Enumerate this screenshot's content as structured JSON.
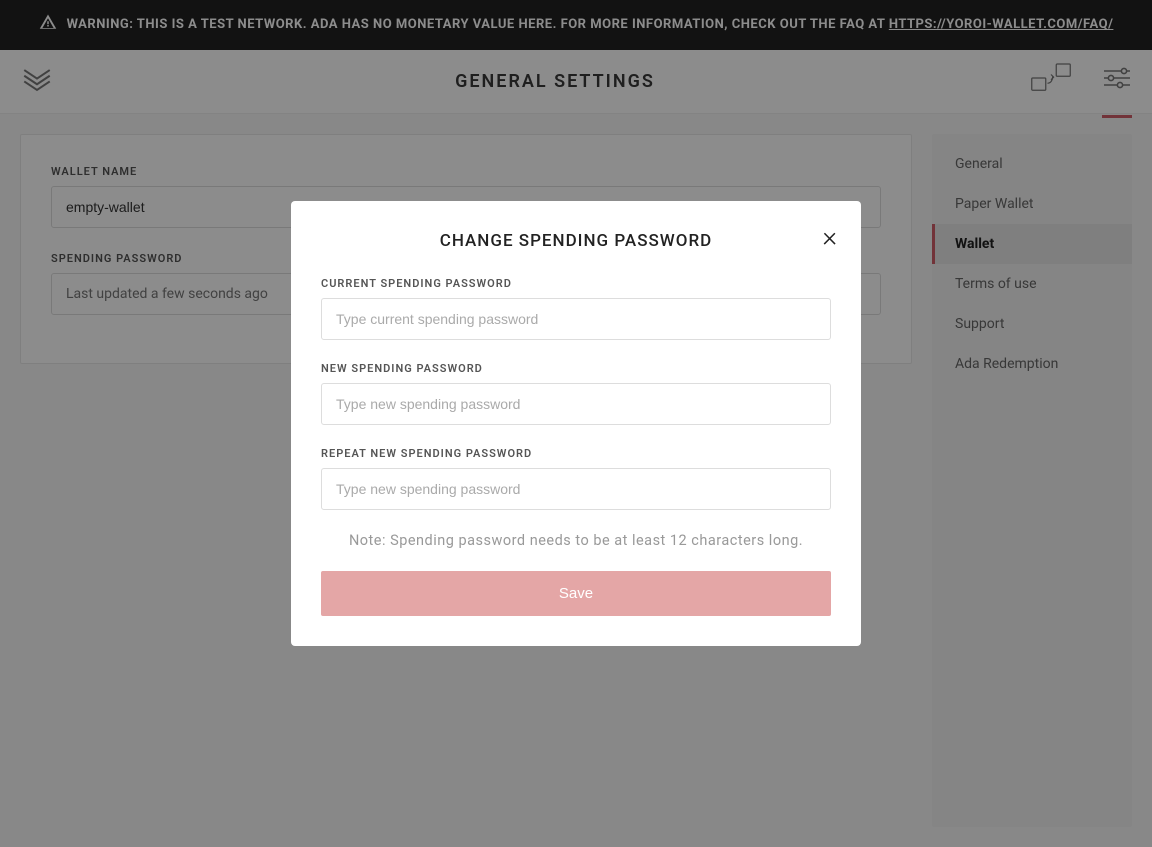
{
  "banner": {
    "prefix": "WARNING: THIS IS A TEST NETWORK. ADA HAS NO MONETARY VALUE HERE. FOR MORE INFORMATION, CHECK OUT THE FAQ AT ",
    "link_text": "HTTPS://YOROI-WALLET.COM/FAQ/"
  },
  "header": {
    "title": "GENERAL SETTINGS"
  },
  "main": {
    "wallet_name_label": "WALLET NAME",
    "wallet_name_value": "empty-wallet",
    "spending_password_label": "SPENDING PASSWORD",
    "spending_password_value": "Last updated a few seconds ago"
  },
  "sidebar": {
    "items": [
      {
        "label": "General",
        "active": false
      },
      {
        "label": "Paper Wallet",
        "active": false
      },
      {
        "label": "Wallet",
        "active": true
      },
      {
        "label": "Terms of use",
        "active": false
      },
      {
        "label": "Support",
        "active": false
      },
      {
        "label": "Ada Redemption",
        "active": false
      }
    ]
  },
  "modal": {
    "title": "CHANGE SPENDING PASSWORD",
    "current_label": "CURRENT SPENDING PASSWORD",
    "current_placeholder": "Type current spending password",
    "new_label": "NEW SPENDING PASSWORD",
    "new_placeholder": "Type new spending password",
    "repeat_label": "REPEAT NEW SPENDING PASSWORD",
    "repeat_placeholder": "Type new spending password",
    "note": "Note: Spending password needs to be at least 12 characters long.",
    "save_label": "Save"
  }
}
